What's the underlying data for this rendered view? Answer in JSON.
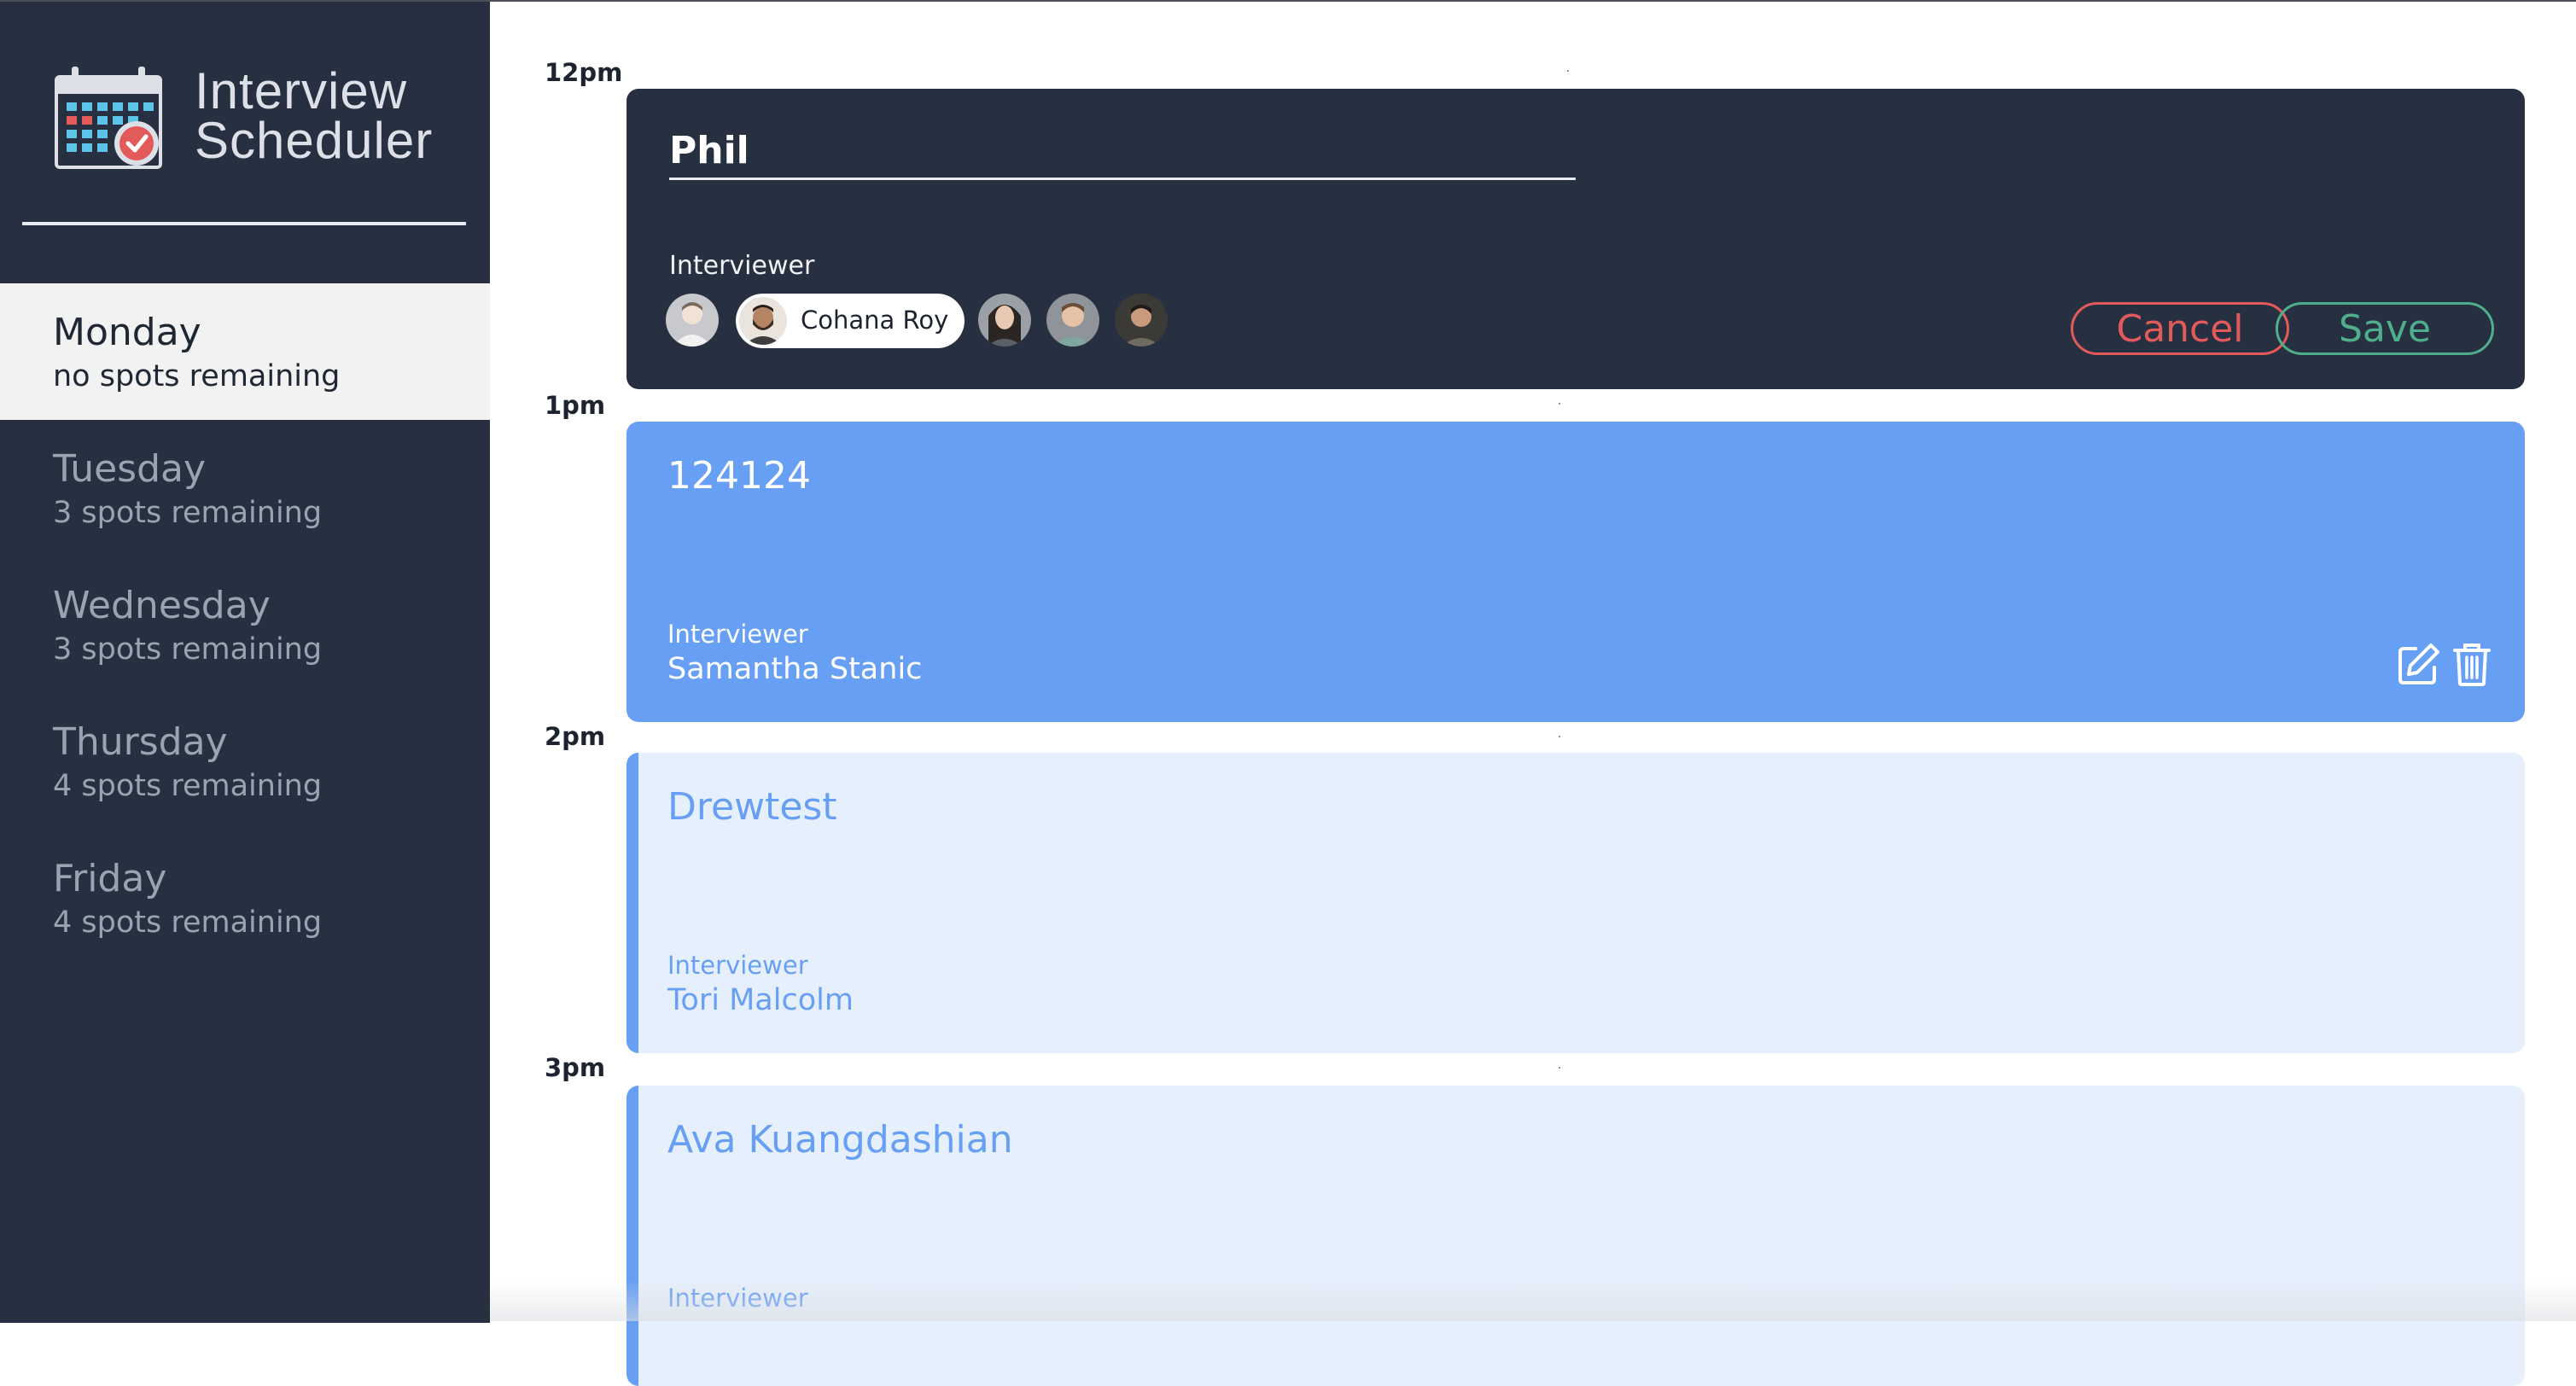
{
  "app": {
    "title_line1": "Interview",
    "title_line2": "Scheduler"
  },
  "days": [
    {
      "name": "Monday",
      "spots": "no spots remaining",
      "selected": true
    },
    {
      "name": "Tuesday",
      "spots": "3 spots remaining",
      "selected": false
    },
    {
      "name": "Wednesday",
      "spots": "3 spots remaining",
      "selected": false
    },
    {
      "name": "Thursday",
      "spots": "4 spots remaining",
      "selected": false
    },
    {
      "name": "Friday",
      "spots": "4 spots remaining",
      "selected": false
    }
  ],
  "times": [
    "12pm",
    "1pm",
    "2pm",
    "3pm"
  ],
  "form": {
    "student_name_value": "Phil",
    "interviewer_label": "Interviewer",
    "selected_interviewer": "Cohana Roy",
    "cancel_label": "Cancel",
    "save_label": "Save"
  },
  "appointments": [
    {
      "student": "124124",
      "interviewer_label": "Interviewer",
      "interviewer": "Samantha Stanic"
    },
    {
      "student": "Drewtest",
      "interviewer_label": "Interviewer",
      "interviewer": "Tori Malcolm"
    },
    {
      "student": "Ava Kuangdashian",
      "interviewer_label": "Interviewer",
      "interviewer": ""
    }
  ],
  "colors": {
    "sidebar_bg": "#263040",
    "selected_day_bg": "#f2f2f2",
    "booked_blue": "#679ff4",
    "light_blue": "#e6effc",
    "cancel_red": "#e35a5a",
    "save_green": "#4fae8c"
  },
  "icons": {
    "logo": "calendar-check-icon",
    "edit": "edit-icon",
    "delete": "trash-icon"
  }
}
